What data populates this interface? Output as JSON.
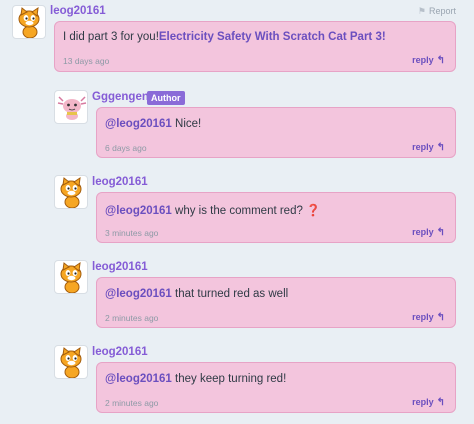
{
  "report_label": "Report",
  "top_comment": {
    "username": "leog20161",
    "text": "I did part 3 for you!",
    "link_text": "Electricity Safety With Scratch Cat Part 3!",
    "time": "13 days ago",
    "reply_label": "reply"
  },
  "replies": [
    {
      "username": "Gggengen",
      "badge": "Author",
      "mention": "@leog20161",
      "text": " Nice!",
      "time": "6 days ago",
      "reply_label": "reply"
    },
    {
      "username": "leog20161",
      "mention": "@leog20161",
      "text": " why is the comment red? ",
      "emoji": "❓",
      "time": "3 minutes ago",
      "reply_label": "reply"
    },
    {
      "username": "leog20161",
      "mention": "@leog20161",
      "text": " that turned red as well",
      "time": "2 minutes ago",
      "reply_label": "reply"
    },
    {
      "username": "leog20161",
      "mention": "@leog20161",
      "text": " they keep turning red!",
      "time": "2 minutes ago",
      "reply_label": "reply"
    }
  ],
  "colors": {
    "bubble": "#f3c5dd",
    "bubble_border": "#e7a3c6",
    "username": "#855cd6",
    "link": "#6b4fbf",
    "badge": "#8a6bd8"
  }
}
